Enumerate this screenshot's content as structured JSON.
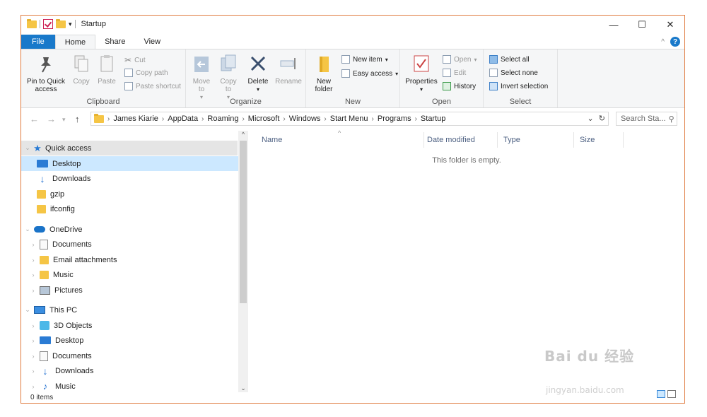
{
  "window": {
    "title": "Startup"
  },
  "tabs": [
    "File",
    "Home",
    "Share",
    "View"
  ],
  "ribbon": {
    "clipboard": {
      "label": "Clipboard",
      "pin": "Pin to Quick access",
      "copy": "Copy",
      "paste": "Paste",
      "cut": "Cut",
      "copy_path": "Copy path",
      "paste_shortcut": "Paste shortcut"
    },
    "organize": {
      "label": "Organize",
      "move_to": "Move to",
      "copy_to": "Copy to",
      "delete": "Delete",
      "rename": "Rename"
    },
    "new": {
      "label": "New",
      "new_folder": "New folder",
      "new_item": "New item",
      "easy_access": "Easy access"
    },
    "open": {
      "label": "Open",
      "properties": "Properties",
      "open": "Open",
      "edit": "Edit",
      "history": "History"
    },
    "select": {
      "label": "Select",
      "select_all": "Select all",
      "select_none": "Select none",
      "invert": "Invert selection"
    }
  },
  "address": {
    "crumbs": [
      "James Kiarie",
      "AppData",
      "Roaming",
      "Microsoft",
      "Windows",
      "Start Menu",
      "Programs",
      "Startup"
    ],
    "search_placeholder": "Search Sta..."
  },
  "nav": {
    "quick_access": "Quick access",
    "quick_items": [
      "Desktop",
      "Downloads",
      "gzip",
      "ifconfig"
    ],
    "onedrive": "OneDrive",
    "onedrive_items": [
      "Documents",
      "Email attachments",
      "Music",
      "Pictures"
    ],
    "this_pc": "This PC",
    "pc_items": [
      "3D Objects",
      "Desktop",
      "Documents",
      "Downloads",
      "Music"
    ]
  },
  "columns": [
    "Name",
    "Date modified",
    "Type",
    "Size"
  ],
  "empty_message": "This folder is empty.",
  "status": "0 items",
  "watermark": {
    "brand": "Bai du 经验",
    "url": "jingyan.baidu.com"
  },
  "colors": {
    "accent": "#1979ca",
    "selection": "#cce8ff",
    "border": "#e07b40"
  }
}
